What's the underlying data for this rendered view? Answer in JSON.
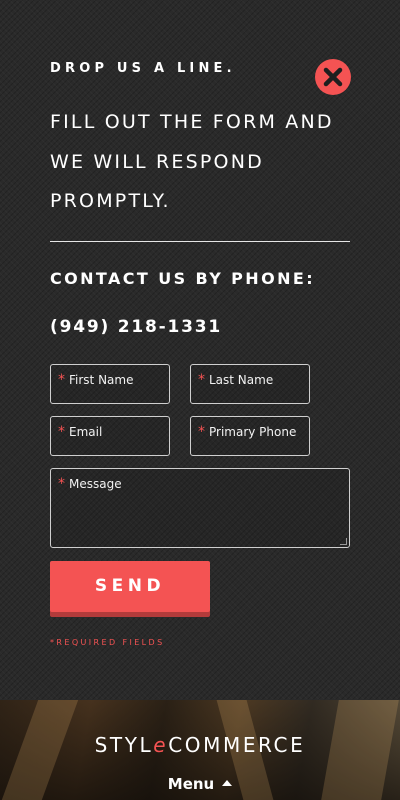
{
  "contact": {
    "kicker": "DROP US A LINE.",
    "headline": "FILL OUT THE FORM AND WE WILL RESPOND PROMPTLY.",
    "phone_heading": "CONTACT US BY PHONE:",
    "phone_number": "(949) 218-1331",
    "close_icon": "close-icon"
  },
  "form": {
    "required_marker": "*",
    "first_name": "First Name",
    "last_name": "Last Name",
    "email": "Email",
    "primary_phone": "Primary Phone",
    "message": "Message",
    "send_label": "SEND",
    "required_note": "*REQUIRED FIELDS"
  },
  "footer": {
    "logo_part1": "STYL",
    "logo_accent": "e",
    "logo_part2": "COMMERCE",
    "menu_label": "Menu"
  },
  "colors": {
    "accent": "#f45353",
    "background": "#2a2a2a",
    "text": "#ffffff"
  }
}
